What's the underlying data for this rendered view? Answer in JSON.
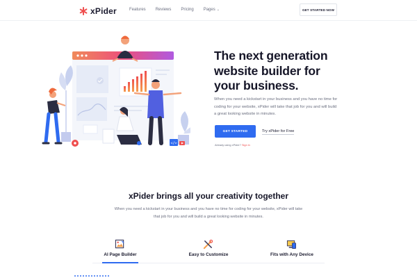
{
  "nav": {
    "logo": "xPider",
    "menu": [
      "Features",
      "Reviews",
      "Pricing",
      "Pages"
    ],
    "cta": "GET STARTED NOW"
  },
  "hero": {
    "title": "The next generation website builder for your business.",
    "text": "When you need a kickstart in your business and you have no time for coding for your website, xPider will take that job for you and will build a great looking website in minutes.",
    "primary_button": "GET STARTED",
    "secondary_link": "Try xPider for Free",
    "already_text": "Already using xPider?",
    "signin_text": "Sign in",
    "illustration_icons": [
      "person-watering-plant-illustration",
      "person-presenting-chart-illustration",
      "gear-icon",
      "code-icon",
      "play-icon"
    ]
  },
  "features": {
    "title": "xPider brings all your creativity together",
    "text": "When you need a kickstart in your business and you have no time for coding for your website, xPider will take that job for you and will build a great looking website in minutes.",
    "tabs": [
      {
        "label": "AI Page Builder",
        "icon": "image-edit-icon",
        "active": true
      },
      {
        "label": "Easy to Customize",
        "icon": "tools-icon",
        "active": false
      },
      {
        "label": "Fits with Any Device",
        "icon": "devices-icon",
        "active": false
      }
    ]
  },
  "colors": {
    "accent": "#2f6bf0",
    "brand": "#ef4f4f",
    "text": "#161628"
  }
}
